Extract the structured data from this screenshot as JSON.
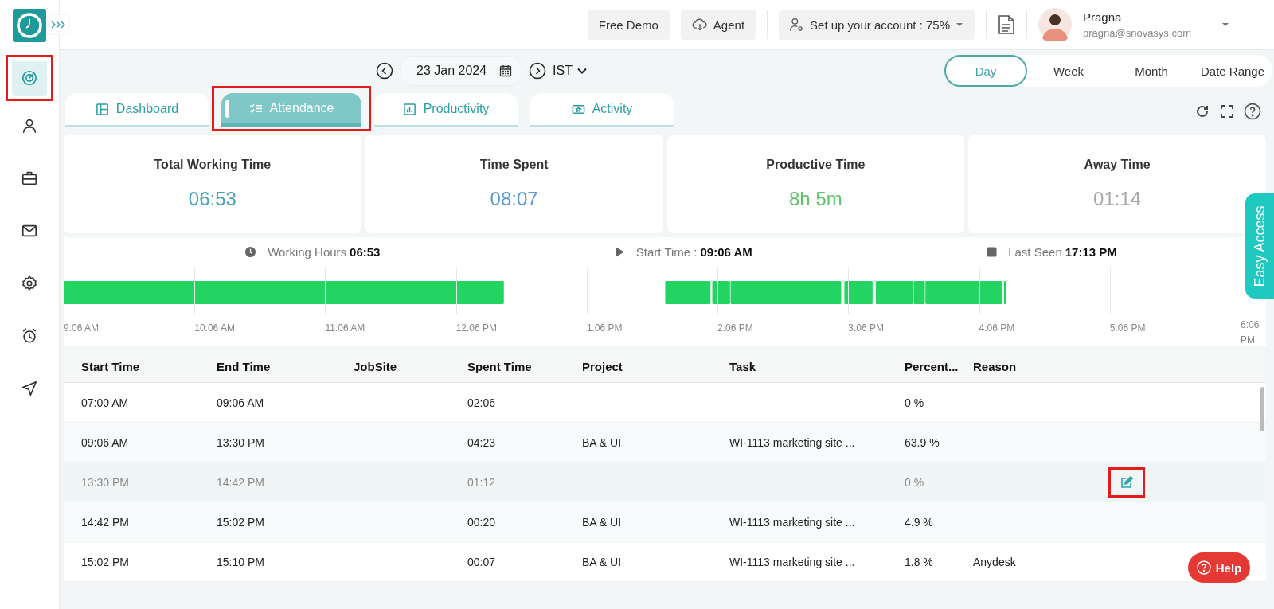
{
  "header": {
    "buttons": [
      {
        "label": "Free Demo",
        "kind": "plain"
      },
      {
        "label": "Agent",
        "kind": "cloud"
      }
    ],
    "setup": {
      "label": "Set up your account : 75%"
    },
    "user": {
      "name": "Pragna",
      "email": "pragna@snovasys.com"
    }
  },
  "sidebar": {
    "items": [
      {
        "selected": true,
        "highlighted": true
      },
      {
        "selected": false,
        "highlighted": false
      },
      {
        "selected": false,
        "highlighted": false
      },
      {
        "selected": false,
        "highlighted": false
      },
      {
        "selected": false,
        "highlighted": false
      },
      {
        "selected": false,
        "highlighted": false
      },
      {
        "selected": false,
        "highlighted": false
      }
    ]
  },
  "date_bar": {
    "date": "23 Jan 2024",
    "timezone": "IST"
  },
  "range_tabs": [
    {
      "label": "Day",
      "selected": true
    },
    {
      "label": "Week",
      "selected": false
    },
    {
      "label": "Month",
      "selected": false
    },
    {
      "label": "Date Range",
      "selected": false
    }
  ],
  "tabs": [
    {
      "label": "Dashboard",
      "selected": false,
      "highlighted": false
    },
    {
      "label": "Attendance",
      "selected": true,
      "highlighted": true
    },
    {
      "label": "Productivity",
      "selected": false,
      "highlighted": false
    },
    {
      "label": "Activity",
      "selected": false,
      "highlighted": false
    }
  ],
  "stats": [
    {
      "label": "Total Working Time",
      "value": "06:53",
      "color": "#4aa3b5"
    },
    {
      "label": "Time Spent",
      "value": "08:07",
      "color": "#5b9bd5"
    },
    {
      "label": "Productive Time",
      "value": "8h 5m",
      "color": "#5cc46b"
    },
    {
      "label": "Away Time",
      "value": "01:14",
      "color": "#a8a8a8"
    }
  ],
  "summary": [
    {
      "kind": "clock",
      "label": "Working Hours",
      "value": "06:53"
    },
    {
      "kind": "play",
      "label": "Start Time :",
      "value": "09:06 AM"
    },
    {
      "kind": "stop",
      "label": "Last Seen",
      "value": "17:13 PM"
    }
  ],
  "timeline": {
    "ticks": [
      "9:06 AM",
      "10:06 AM",
      "11:06 AM",
      "12:06 PM",
      "1:06 PM",
      "2:06 PM",
      "3:06 PM",
      "4:06 PM",
      "5:06 PM",
      "6:06 PM"
    ]
  },
  "table": {
    "columns": [
      "Start Time",
      "End Time",
      "JobSite",
      "Spent Time",
      "Project",
      "Task",
      "Percent...",
      "Reason"
    ],
    "rows": [
      {
        "cells": [
          "07:00 AM",
          "09:06 AM",
          "",
          "02:06",
          "",
          "",
          "0 %",
          ""
        ],
        "idle": false,
        "editable": false,
        "highlighted": false
      },
      {
        "cells": [
          "09:06 AM",
          "13:30 PM",
          "",
          "04:23",
          "BA & UI",
          "WI-1113 marketing site ...",
          "63.9 %",
          ""
        ],
        "idle": false,
        "editable": false,
        "highlighted": false
      },
      {
        "cells": [
          "13:30 PM",
          "14:42 PM",
          "",
          "01:12",
          "",
          "",
          "0 %",
          ""
        ],
        "idle": true,
        "editable": true,
        "highlighted": true
      },
      {
        "cells": [
          "14:42 PM",
          "15:02 PM",
          "",
          "00:20",
          "BA & UI",
          "WI-1113 marketing site ...",
          "4.9 %",
          ""
        ],
        "idle": false,
        "editable": false,
        "highlighted": false
      },
      {
        "cells": [
          "15:02 PM",
          "15:10 PM",
          "",
          "00:07",
          "BA & UI",
          "WI-1113 marketing site ...",
          "1.8 %",
          "Anydesk"
        ],
        "idle": false,
        "editable": false,
        "highlighted": false
      }
    ]
  },
  "easy_access": {
    "label": "Easy Access"
  },
  "help": {
    "label": "Help"
  }
}
